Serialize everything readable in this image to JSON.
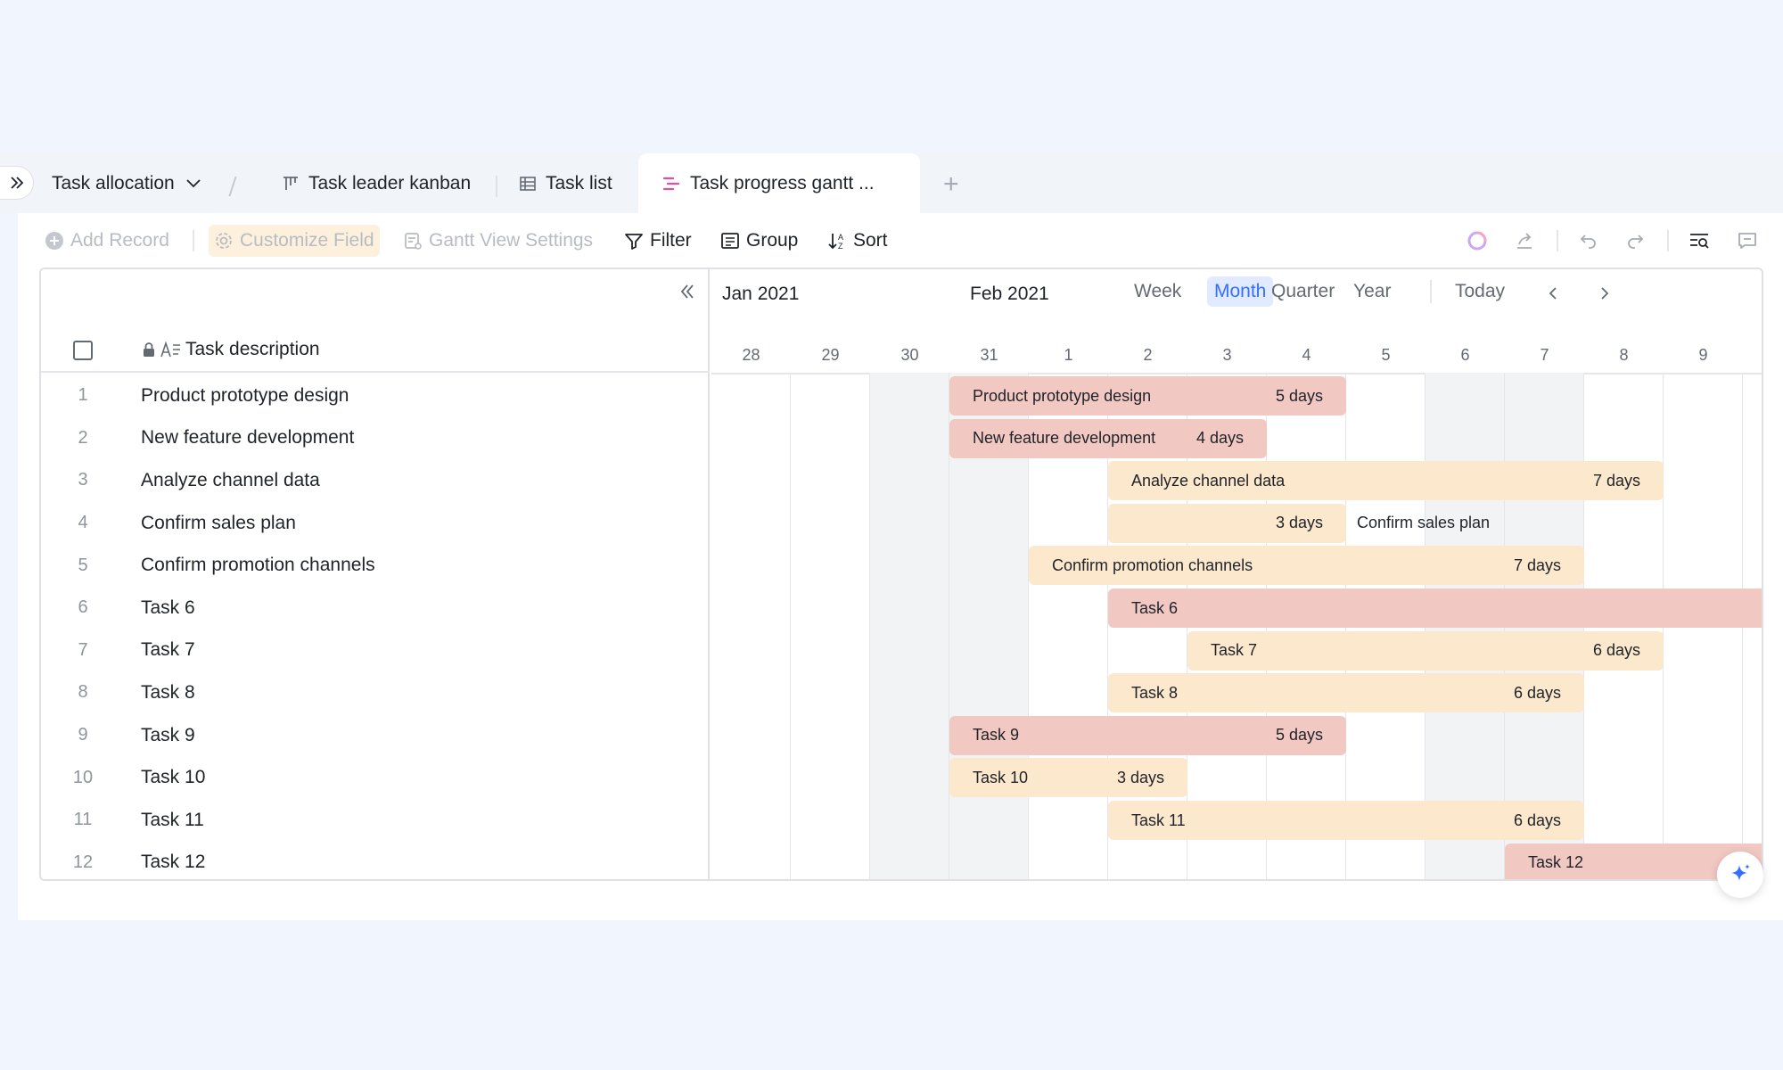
{
  "tabs": {
    "title": "Task allocation",
    "kanban": "Task leader kanban",
    "list": "Task list",
    "gantt": "Task progress gantt ...",
    "add": "+"
  },
  "toolbar": {
    "add_record": "Add Record",
    "customize_field": "Customize Field",
    "gantt_settings": "Gantt View Settings",
    "filter": "Filter",
    "group": "Group",
    "sort": "Sort"
  },
  "grid": {
    "column_header": "Task description",
    "rows": [
      {
        "num": "1",
        "text": "Product prototype design"
      },
      {
        "num": "2",
        "text": "New feature development"
      },
      {
        "num": "3",
        "text": "Analyze channel data"
      },
      {
        "num": "4",
        "text": "Confirm sales plan"
      },
      {
        "num": "5",
        "text": "Confirm promotion channels"
      },
      {
        "num": "6",
        "text": "Task 6"
      },
      {
        "num": "7",
        "text": "Task 7"
      },
      {
        "num": "8",
        "text": "Task 8"
      },
      {
        "num": "9",
        "text": "Task 9"
      },
      {
        "num": "10",
        "text": "Task 10"
      },
      {
        "num": "11",
        "text": "Task 11"
      },
      {
        "num": "12",
        "text": "Task 12"
      }
    ]
  },
  "gantt": {
    "months": [
      "Jan 2021",
      "Feb 2021"
    ],
    "scales": [
      "Week",
      "Month",
      "Quarter",
      "Year"
    ],
    "active_scale": "Month",
    "today": "Today",
    "days": [
      "28",
      "29",
      "30",
      "31",
      "1",
      "2",
      "3",
      "4",
      "5",
      "6",
      "7",
      "8",
      "9"
    ],
    "weekend_days": [
      "30",
      "31",
      "6",
      "7"
    ],
    "bars": [
      {
        "row": 0,
        "name": "Product prototype design",
        "duration": "5 days",
        "start_day": "31",
        "length_days": 5,
        "color": "red"
      },
      {
        "row": 1,
        "name": "New feature development",
        "duration": "4 days",
        "start_day": "31",
        "length_days": 4,
        "color": "red"
      },
      {
        "row": 2,
        "name": "Analyze channel data",
        "duration": "7 days",
        "start_day": "2",
        "length_days": 7,
        "color": "yellow"
      },
      {
        "row": 3,
        "name": "Confirm sales plan",
        "duration": "3 days",
        "start_day": "2",
        "length_days": 3,
        "color": "yellow",
        "label_outside": true
      },
      {
        "row": 4,
        "name": "Confirm promotion channels",
        "duration": "7 days",
        "start_day": "1",
        "length_days": 7,
        "color": "yellow"
      },
      {
        "row": 5,
        "name": "Task 6",
        "duration": "9",
        "start_day": "2",
        "length_days": 9,
        "color": "red",
        "overflow": true
      },
      {
        "row": 6,
        "name": "Task 7",
        "duration": "6 days",
        "start_day": "3",
        "length_days": 6,
        "color": "yellow"
      },
      {
        "row": 7,
        "name": "Task 8",
        "duration": "6 days",
        "start_day": "2",
        "length_days": 6,
        "color": "yellow"
      },
      {
        "row": 8,
        "name": "Task 9",
        "duration": "5 days",
        "start_day": "31",
        "length_days": 5,
        "color": "red"
      },
      {
        "row": 9,
        "name": "Task 10",
        "duration": "3 days",
        "start_day": "31",
        "length_days": 3,
        "color": "yellow"
      },
      {
        "row": 10,
        "name": "Task 11",
        "duration": "6 days",
        "start_day": "2",
        "length_days": 6,
        "color": "yellow"
      },
      {
        "row": 11,
        "name": "Task 12",
        "duration": "",
        "start_day": "7",
        "length_days": 4,
        "color": "red",
        "overflow": true
      }
    ]
  },
  "colors": {
    "accent": "#3370ff",
    "bar_red": "#f2c8c3",
    "bar_yellow": "#fce8cc",
    "gantt_tab_icon": "#e0509e"
  }
}
